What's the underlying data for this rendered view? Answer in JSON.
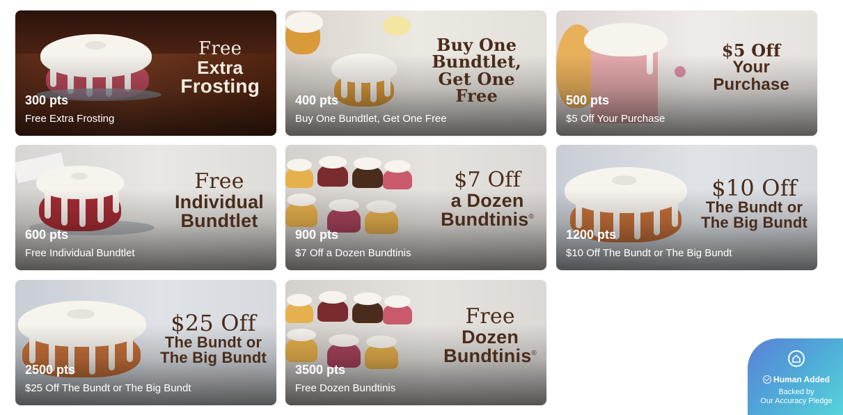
{
  "rewards": [
    {
      "points": "300 pts",
      "description": "Free Extra Frosting",
      "headline": [
        "Free",
        "Extra",
        "Frosting"
      ]
    },
    {
      "points": "400 pts",
      "description": "Buy One Bundtlet, Get One Free",
      "headline": [
        "Buy One",
        "Bundtlet,",
        "Get One",
        "Free"
      ]
    },
    {
      "points": "500 pts",
      "description": "$5 Off Your Purchase",
      "headline": [
        "$5 Off",
        "Your",
        "Purchase"
      ]
    },
    {
      "points": "600 pts",
      "description": "Free Individual Bundtlet",
      "headline": [
        "Free",
        "Individual",
        "Bundtlet"
      ]
    },
    {
      "points": "900 pts",
      "description": "$7 Off a Dozen Bundtinis",
      "headline": [
        "$7 Off",
        "a Dozen",
        "Bundtinis"
      ]
    },
    {
      "points": "1200 pts",
      "description": "$10 Off The Bundt or The Big Bundt",
      "headline": [
        "$10 Off",
        "The Bundt or",
        "The Big Bundt"
      ]
    },
    {
      "points": "2500 pts",
      "description": "$25 Off The Bundt or The Big Bundt",
      "headline": [
        "$25 Off",
        "The Bundt or",
        "The Big Bundt"
      ]
    },
    {
      "points": "3500 pts",
      "description": "Free Dozen Bundtinis",
      "headline": [
        "Free",
        "Dozen",
        "Bundtinis"
      ]
    }
  ],
  "registered_mark": "®",
  "badge": {
    "icon": "shield-home-icon",
    "title": "Human Added",
    "subtitle_line1": "Backed by",
    "subtitle_line2": "Our Accuracy Pledge"
  },
  "colors": {
    "headline_brown": "#4a2c1c",
    "headline_cream": "#f2ebe0",
    "badge_gradient_start": "#5b7fd6",
    "badge_gradient_end": "#56d4da"
  }
}
